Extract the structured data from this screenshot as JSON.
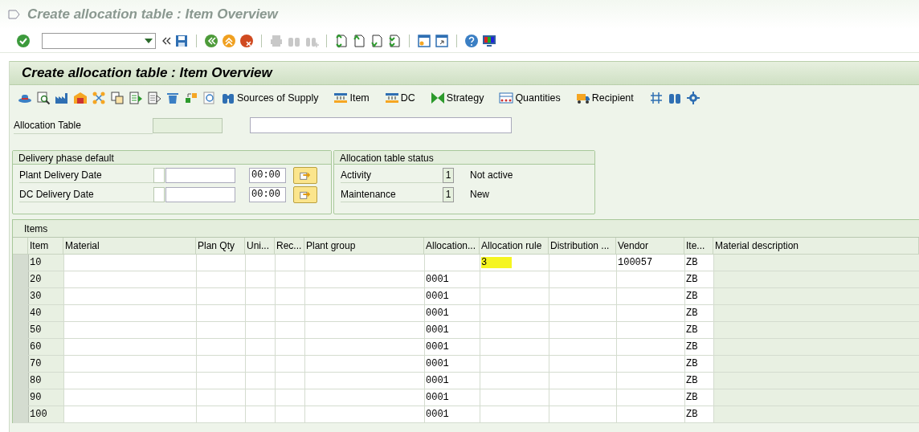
{
  "window": {
    "title": "Create allocation table : Item Overview"
  },
  "screen_title": "Create allocation table : Item Overview",
  "app_toolbar": {
    "buttons": [
      {
        "kind": "sources",
        "label": "Sources of Supply"
      },
      {
        "kind": "item",
        "label": "Item"
      },
      {
        "kind": "dc",
        "label": "DC"
      },
      {
        "kind": "strategy",
        "label": "Strategy"
      },
      {
        "kind": "quantities",
        "label": "Quantities"
      },
      {
        "kind": "recipient",
        "label": "Recipient"
      }
    ]
  },
  "header": {
    "label": "Allocation Table"
  },
  "delivery_phase": {
    "title": "Delivery phase default",
    "rows": [
      {
        "label": "Plant Delivery Date",
        "checked": false,
        "time": "00:00"
      },
      {
        "label": "DC Delivery Date",
        "checked": false,
        "time": "00:00"
      }
    ]
  },
  "status": {
    "title": "Allocation table status",
    "rows": [
      {
        "label": "Activity",
        "code": "1",
        "text": "Not active"
      },
      {
        "label": "Maintenance",
        "code": "1",
        "text": "New"
      }
    ]
  },
  "items": {
    "title": "Items",
    "columns": [
      "Item",
      "Material",
      "Plan Qty",
      "Uni...",
      "Rec...",
      "Plant group",
      "Allocation...",
      "Allocation rule",
      "Distribution ...",
      "Vendor",
      "Ite...",
      "Material description"
    ],
    "rows": [
      {
        "cells": [
          "10",
          "",
          "",
          "",
          "",
          "",
          "",
          "3",
          "",
          "100057",
          "ZB",
          ""
        ],
        "highlighted": true
      },
      {
        "cells": [
          "20",
          "",
          "",
          "",
          "",
          "",
          "0001",
          "",
          "",
          "",
          "ZB",
          ""
        ],
        "highlighted": false
      },
      {
        "cells": [
          "30",
          "",
          "",
          "",
          "",
          "",
          "0001",
          "",
          "",
          "",
          "ZB",
          ""
        ],
        "highlighted": false
      },
      {
        "cells": [
          "40",
          "",
          "",
          "",
          "",
          "",
          "0001",
          "",
          "",
          "",
          "ZB",
          ""
        ],
        "highlighted": false
      },
      {
        "cells": [
          "50",
          "",
          "",
          "",
          "",
          "",
          "0001",
          "",
          "",
          "",
          "ZB",
          ""
        ],
        "highlighted": false
      },
      {
        "cells": [
          "60",
          "",
          "",
          "",
          "",
          "",
          "0001",
          "",
          "",
          "",
          "ZB",
          ""
        ],
        "highlighted": false
      },
      {
        "cells": [
          "70",
          "",
          "",
          "",
          "",
          "",
          "0001",
          "",
          "",
          "",
          "ZB",
          ""
        ],
        "highlighted": false
      },
      {
        "cells": [
          "80",
          "",
          "",
          "",
          "",
          "",
          "0001",
          "",
          "",
          "",
          "ZB",
          ""
        ],
        "highlighted": false
      },
      {
        "cells": [
          "90",
          "",
          "",
          "",
          "",
          "",
          "0001",
          "",
          "",
          "",
          "ZB",
          ""
        ],
        "highlighted": false
      },
      {
        "cells": [
          "100",
          "",
          "",
          "",
          "",
          "",
          "0001",
          "",
          "",
          "",
          "ZB",
          ""
        ],
        "highlighted": false
      }
    ]
  }
}
